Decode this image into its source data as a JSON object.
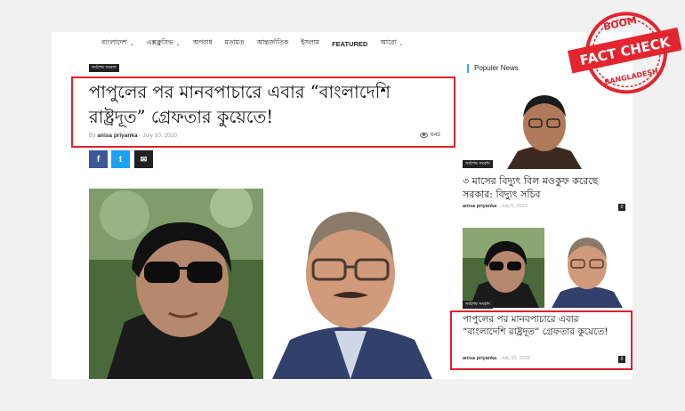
{
  "nav": {
    "items": [
      {
        "label": "বাংলাদেশ",
        "dropdown": true
      },
      {
        "label": "এক্সক্লুসিভ",
        "dropdown": true
      },
      {
        "label": "অপরাধ",
        "dropdown": false
      },
      {
        "label": "মতামত",
        "dropdown": false
      },
      {
        "label": "আন্তর্জাতিক",
        "dropdown": false
      },
      {
        "label": "ইসলাম",
        "dropdown": false
      },
      {
        "label": "FEATURED",
        "dropdown": false
      },
      {
        "label": "আরো",
        "dropdown": true
      }
    ]
  },
  "article": {
    "category": "সর্বশেষ সংবাদ",
    "headline": "পাপুলের পর মানবপাচারে এবার “বাংলাদেশি রাষ্ট্রদূত” গ্রেফতার কুয়েতে!",
    "by": "By",
    "author": "anisa priyanka",
    "date": "- July 10, 2020",
    "views": "649"
  },
  "share": {
    "facebook": "f",
    "twitter": "t",
    "email": "✉"
  },
  "sidebar": {
    "title": "Populer News",
    "posts": [
      {
        "category": "সর্বশেষ সংবাদ",
        "headline": "৩ মাসের বিদ্যুৎ বিল মওকুফ করেছে সরকার: বিদ্যুৎ সচিব",
        "author": "anisa priyanka",
        "date": "- July 5, 2020",
        "comments": "0"
      },
      {
        "category": "সর্বশেষ সংবাদ",
        "headline": "পাপুলের পর মানবপাচারে এবার “বাংলাদেশি রাষ্ট্রদূত” গ্রেফতার কুয়েতে!",
        "author": "anisa priyanka",
        "date": "- July 10, 2020",
        "comments": "0"
      }
    ]
  },
  "stamp": {
    "top": "BOOM",
    "main": "FACT CHECK",
    "bottom": "BANGLADESH"
  },
  "colors": {
    "highlight": "#e0202a",
    "facebook": "#3b5998",
    "twitter": "#1da1f2",
    "email": "#222222",
    "stamp": "#e2252f"
  }
}
